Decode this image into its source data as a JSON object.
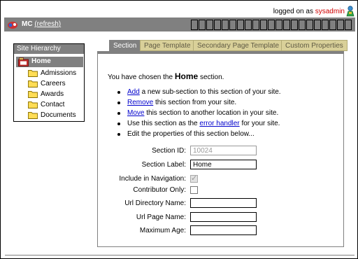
{
  "header": {
    "logged_prefix": "logged on as",
    "user": "sysadmin",
    "app_name": "MC",
    "refresh_label": "(refresh)",
    "title_box_count": 21
  },
  "sidebar": {
    "title": "Site Hierarchy",
    "root": "Home",
    "items": [
      {
        "label": "Admissions"
      },
      {
        "label": "Careers"
      },
      {
        "label": "Awards"
      },
      {
        "label": "Contact"
      },
      {
        "label": "Documents"
      }
    ]
  },
  "tabs": [
    {
      "label": "Section",
      "active": true
    },
    {
      "label": "Page Template",
      "active": false
    },
    {
      "label": "Secondary Page Template",
      "active": false
    },
    {
      "label": "Custom Properties",
      "active": false
    }
  ],
  "main": {
    "intro_prefix": "You have chosen the",
    "section_name": "Home",
    "intro_suffix": "section.",
    "actions": {
      "add_link": "Add",
      "add_text": "a new sub-section to this section of your site.",
      "remove_link": "Remove",
      "remove_text": "this section from your site.",
      "move_link": "Move",
      "move_text": "this section to another location in your site.",
      "handler_prefix": "Use this section as the",
      "handler_link": "error handler",
      "handler_suffix": "for your site.",
      "edit_text": "Edit the properties of this section below..."
    },
    "form": {
      "section_id_label": "Section ID:",
      "section_id_value": "10024",
      "section_label_label": "Section Label:",
      "section_label_value": "Home",
      "include_nav_label": "Include in Navigation:",
      "include_nav_checked": true,
      "contributor_only_label": "Contributor Only:",
      "contributor_only_checked": false,
      "url_dir_label": "Url Directory Name:",
      "url_dir_value": "",
      "url_page_label": "Url Page Name:",
      "url_page_value": "",
      "max_age_label": "Maximum Age:",
      "max_age_value": ""
    }
  },
  "colors": {
    "bar": "#808080",
    "tab_inactive": "#d9d099",
    "user_red": "#d00000",
    "link_blue": "#0000cc"
  }
}
